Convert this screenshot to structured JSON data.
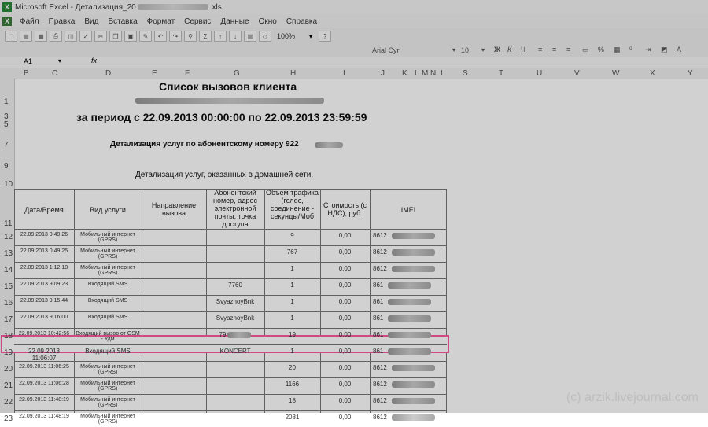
{
  "window": {
    "app_title": "Microsoft Excel - Детализация_20",
    "file_ext": ".xls"
  },
  "menu": [
    "Файл",
    "Правка",
    "Вид",
    "Вставка",
    "Формат",
    "Сервис",
    "Данные",
    "Окно",
    "Справка"
  ],
  "toolbar": {
    "zoom": "100%",
    "font_name": "Arial Cyr",
    "font_size": "10"
  },
  "namebox": "A1",
  "fx": "fx",
  "columns": [
    "B",
    "C",
    "D",
    "E",
    "F",
    "G",
    "H",
    "I",
    "J",
    "K",
    "L",
    "M",
    "N",
    "I",
    "S",
    "T",
    "U",
    "V",
    "W",
    "X",
    "Y"
  ],
  "sheet": {
    "title": "Список вызовов клиента",
    "period": "за период с 22.09.2013 00:00:00  по  22.09.2013 23:59:59",
    "detail_number": "Детализация услуг по абонентскому номеру  922",
    "home_network": "Детализация услуг, оказанных в домашней сети.",
    "headers": {
      "datetime": "Дата/Время",
      "service": "Вид услуги",
      "direction": "Направление вызова",
      "subscriber": "Абонентский номер, адрес электронной почты, точка доступа",
      "traffic": "Объем трафика (голос, соединение - секунды/Моб",
      "cost": "Стоимость (с НДС), руб.",
      "imei": "IMEI"
    },
    "rows": [
      {
        "n": "12",
        "datetime": "22.09.2013 0:49:26",
        "service": "Мобильный интернет (GPRS)",
        "subscriber": "",
        "traffic": "9",
        "cost": "0,00",
        "imei": "8612"
      },
      {
        "n": "13",
        "datetime": "22.09.2013 0:49:25",
        "service": "Мобильный интернет (GPRS)",
        "subscriber": "",
        "traffic": "767",
        "cost": "0,00",
        "imei": "8612"
      },
      {
        "n": "14",
        "datetime": "22.09.2013 1:12:18",
        "service": "Мобильный интернет (GPRS)",
        "subscriber": "",
        "traffic": "1",
        "cost": "0,00",
        "imei": "8612"
      },
      {
        "n": "15",
        "datetime": "22.09.2013 9:09:23",
        "service": "Входящий SMS",
        "subscriber": "7760",
        "traffic": "1",
        "cost": "0,00",
        "imei": "861"
      },
      {
        "n": "16",
        "datetime": "22.09.2013 9:15:44",
        "service": "Входящий SMS",
        "subscriber": "SvyaznoyBnk",
        "traffic": "1",
        "cost": "0,00",
        "imei": "861"
      },
      {
        "n": "17",
        "datetime": "22.09.2013 9:16:00",
        "service": "Входящий SMS",
        "subscriber": "SvyaznoyBnk",
        "traffic": "1",
        "cost": "0,00",
        "imei": "861"
      },
      {
        "n": "18",
        "datetime": "22.09.2013 10:42:56",
        "service": "Входящий вызов от GSM - Удм",
        "subscriber": "79",
        "traffic": "19",
        "cost": "0,00",
        "imei": "861"
      },
      {
        "n": "19",
        "datetime": "22.09.2013 11:06:07",
        "service": "Входящий SMS",
        "subscriber": "KONCERT",
        "traffic": "1",
        "cost": "0,00",
        "imei": "861"
      },
      {
        "n": "20",
        "datetime": "22.09.2013 11:06:25",
        "service": "Мобильный интернет (GPRS)",
        "subscriber": "",
        "traffic": "20",
        "cost": "0,00",
        "imei": "8612"
      },
      {
        "n": "21",
        "datetime": "22.09.2013 11:06:28",
        "service": "Мобильный интернет (GPRS)",
        "subscriber": "",
        "traffic": "1166",
        "cost": "0,00",
        "imei": "8612"
      },
      {
        "n": "22",
        "datetime": "22.09.2013 11:48:19",
        "service": "Мобильный интернет (GPRS)",
        "subscriber": "",
        "traffic": "18",
        "cost": "0,00",
        "imei": "8612"
      },
      {
        "n": "23",
        "datetime": "22.09.2013 11:48:19",
        "service": "Мобильный интернет (GPRS)",
        "subscriber": "",
        "traffic": "2081",
        "cost": "0,00",
        "imei": "8612"
      }
    ]
  },
  "watermark": "(c)  arzik.livejournal.com"
}
